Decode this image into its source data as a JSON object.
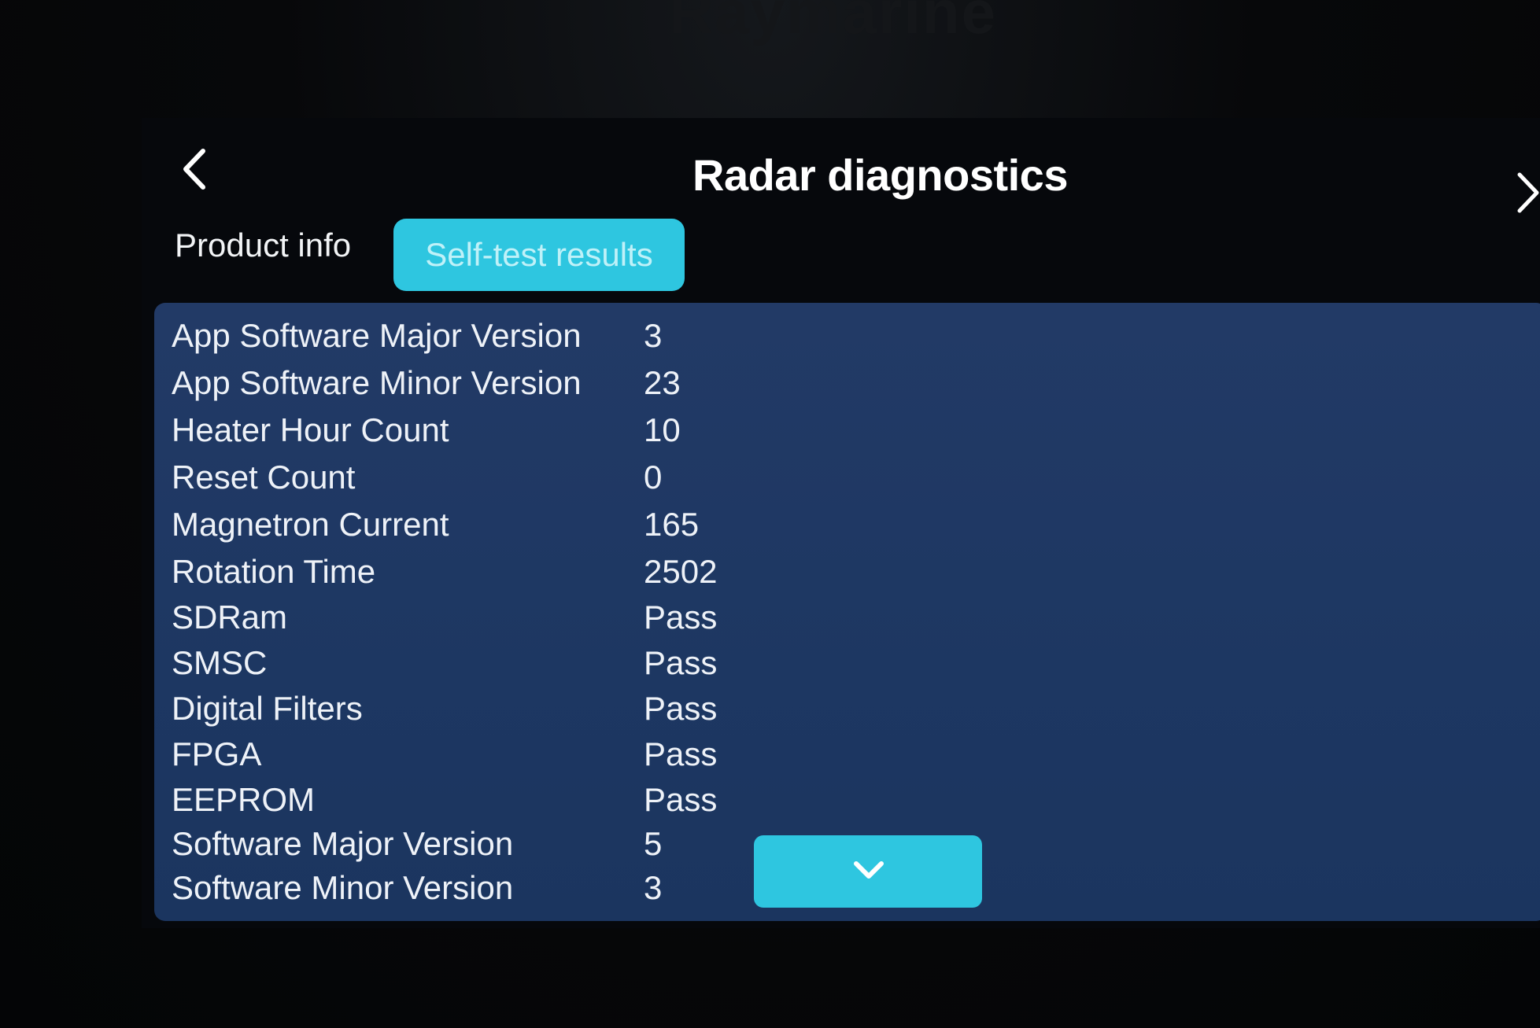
{
  "brand": "Raymarine",
  "header": {
    "title": "Radar diagnostics",
    "back_icon": "chevron-left-icon",
    "next_icon": "chevron-right-icon"
  },
  "tabs": [
    {
      "label": "Product info",
      "active": false
    },
    {
      "label": "Self-test results",
      "active": true
    }
  ],
  "results": [
    {
      "label": "App Software Major Version",
      "value": "3"
    },
    {
      "label": "App Software Minor Version",
      "value": "23"
    },
    {
      "label": "Heater Hour Count",
      "value": "10"
    },
    {
      "label": "Reset Count",
      "value": "0"
    },
    {
      "label": "Magnetron Current",
      "value": "165"
    },
    {
      "label": "Rotation Time",
      "value": "2502"
    },
    {
      "label": "SDRam",
      "value": "Pass"
    },
    {
      "label": "SMSC",
      "value": "Pass"
    },
    {
      "label": "Digital Filters",
      "value": "Pass"
    },
    {
      "label": "FPGA",
      "value": "Pass"
    },
    {
      "label": "EEPROM",
      "value": "Pass"
    },
    {
      "label": "Software Major Version",
      "value": "5"
    },
    {
      "label": "Software Minor Version",
      "value": "3"
    }
  ],
  "scroll_button": {
    "icon": "chevron-down-icon"
  },
  "colors": {
    "accent": "#2ec6e0",
    "panel": "#1d3762",
    "background": "#06080c",
    "text": "#ffffff"
  }
}
